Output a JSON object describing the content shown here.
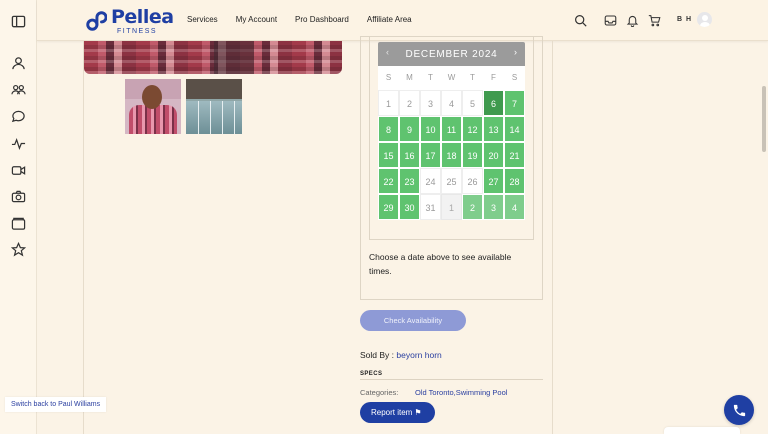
{
  "header": {
    "logo": {
      "name": "Pellea",
      "tagline": "FITNESS"
    },
    "nav": [
      "Services",
      "My Account",
      "Pro Dashboard",
      "Affiliate Area"
    ],
    "user_initials": "B H",
    "icons": [
      "search-icon",
      "inbox-icon",
      "bell-icon",
      "cart-icon"
    ]
  },
  "sidebar": {
    "icons": [
      "sidebar-toggle-icon",
      "user-icon",
      "group-icon",
      "chat-icon",
      "activity-icon",
      "video-icon",
      "camera-icon",
      "wallet-icon",
      "star-icon"
    ]
  },
  "calendar": {
    "month": "DECEMBER 2024",
    "prev": "‹",
    "next": "›",
    "weekdays": [
      "S",
      "M",
      "T",
      "W",
      "T",
      "F",
      "S"
    ],
    "days": [
      {
        "d": "1",
        "s": "na"
      },
      {
        "d": "2",
        "s": "na"
      },
      {
        "d": "3",
        "s": "na"
      },
      {
        "d": "4",
        "s": "na"
      },
      {
        "d": "5",
        "s": "na"
      },
      {
        "d": "6",
        "s": "sel"
      },
      {
        "d": "7",
        "s": "av"
      },
      {
        "d": "8",
        "s": "av"
      },
      {
        "d": "9",
        "s": "av"
      },
      {
        "d": "10",
        "s": "av"
      },
      {
        "d": "11",
        "s": "av"
      },
      {
        "d": "12",
        "s": "av"
      },
      {
        "d": "13",
        "s": "av"
      },
      {
        "d": "14",
        "s": "av"
      },
      {
        "d": "15",
        "s": "av"
      },
      {
        "d": "16",
        "s": "av"
      },
      {
        "d": "17",
        "s": "av"
      },
      {
        "d": "18",
        "s": "av"
      },
      {
        "d": "19",
        "s": "av"
      },
      {
        "d": "20",
        "s": "av"
      },
      {
        "d": "21",
        "s": "av"
      },
      {
        "d": "22",
        "s": "av"
      },
      {
        "d": "23",
        "s": "av"
      },
      {
        "d": "24",
        "s": "na"
      },
      {
        "d": "25",
        "s": "na"
      },
      {
        "d": "26",
        "s": "na"
      },
      {
        "d": "27",
        "s": "av"
      },
      {
        "d": "28",
        "s": "av"
      },
      {
        "d": "29",
        "s": "av"
      },
      {
        "d": "30",
        "s": "av"
      },
      {
        "d": "31",
        "s": "na"
      },
      {
        "d": "1",
        "s": "nx-na"
      },
      {
        "d": "2",
        "s": "nx"
      },
      {
        "d": "3",
        "s": "nx"
      },
      {
        "d": "4",
        "s": "nx"
      }
    ]
  },
  "booking": {
    "choose_text": "Choose a date above to see available times.",
    "check_button": "Check Availability"
  },
  "seller": {
    "label": "Sold By : ",
    "name": "beyorn horn"
  },
  "specs": {
    "heading": "SPECS",
    "categories_label": "Categories:",
    "categories_value": "Old Toronto,Swimming Pool"
  },
  "report_button": "Report item",
  "switch_back": "Switch back to Paul Williams",
  "colors": {
    "brand": "#1f3fa3",
    "available": "#5fc36f",
    "selected": "#3f9a4e",
    "background": "#fbf3e6"
  }
}
